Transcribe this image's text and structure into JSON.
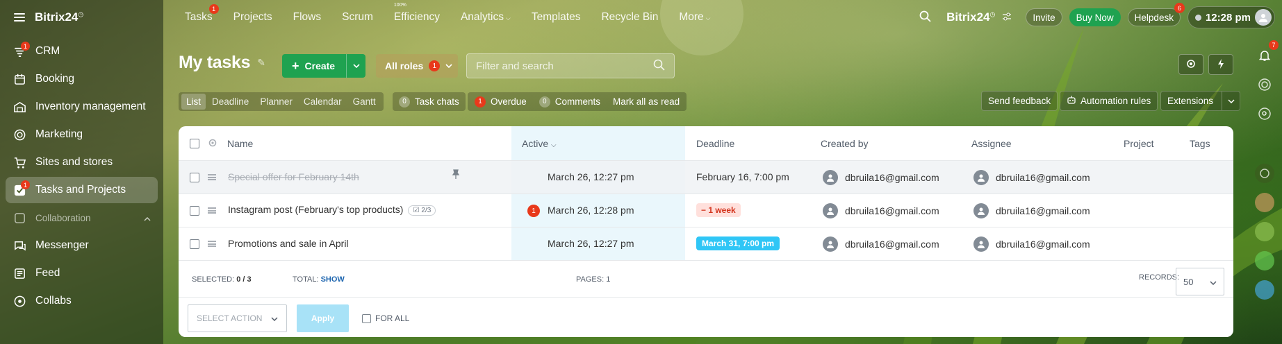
{
  "brand": {
    "name": "Bitrix24",
    "mark": "◷"
  },
  "sidebar": {
    "items": [
      {
        "label": "CRM",
        "badge": "1"
      },
      {
        "label": "Booking"
      },
      {
        "label": "Inventory management"
      },
      {
        "label": "Marketing"
      },
      {
        "label": "Sites and stores"
      },
      {
        "label": "Tasks and Projects",
        "badge": "1"
      }
    ],
    "section": "Collaboration",
    "items2": [
      {
        "label": "Messenger"
      },
      {
        "label": "Feed"
      },
      {
        "label": "Collabs"
      }
    ]
  },
  "topnav": {
    "items": [
      "Tasks",
      "Projects",
      "Flows",
      "Scrum",
      "Efficiency",
      "Analytics",
      "Templates",
      "Recycle Bin",
      "More"
    ],
    "tasks_badge": "1",
    "efficiency_tiny": "100%",
    "invite": "Invite",
    "buy_now": "Buy Now",
    "helpdesk": "Helpdesk",
    "helpdesk_badge": "6",
    "time": "12:28 pm"
  },
  "rail": {
    "notifications_badge": "7"
  },
  "header": {
    "title": "My tasks",
    "create": "Create",
    "roles": "All roles",
    "roles_badge": "1",
    "search_placeholder": "Filter and search"
  },
  "toolbar": {
    "views": [
      "List",
      "Deadline",
      "Planner",
      "Calendar",
      "Gantt"
    ],
    "task_chats_count": "0",
    "task_chats": "Task chats",
    "overdue_count": "1",
    "overdue": "Overdue",
    "comments_count": "0",
    "comments": "Comments",
    "mark_all": "Mark all as read",
    "send_feedback": "Send feedback",
    "automation": "Automation rules",
    "extensions": "Extensions"
  },
  "table": {
    "columns": {
      "name": "Name",
      "active": "Active",
      "deadline": "Deadline",
      "created_by": "Created by",
      "assignee": "Assignee",
      "project": "Project",
      "tags": "Tags"
    },
    "rows": [
      {
        "name": "Special offer for February 14th",
        "active": "March 26, 12:27 pm",
        "deadline": "February 16, 7:00 pm",
        "created_by": "dbruila16@gmail.com",
        "assignee": "dbruila16@gmail.com"
      },
      {
        "name": "Instagram post (February's top products)",
        "checklist": "2/3",
        "counter": "1",
        "active": "March 26, 12:28 pm",
        "deadline": "− 1 week",
        "created_by": "dbruila16@gmail.com",
        "assignee": "dbruila16@gmail.com"
      },
      {
        "name": "Promotions and sale in April",
        "active": "March 26, 12:27 pm",
        "deadline": "March 31, 7:00 pm",
        "created_by": "dbruila16@gmail.com",
        "assignee": "dbruila16@gmail.com"
      }
    ],
    "footer": {
      "selected_label": "Selected:",
      "selected_value": "0 / 3",
      "total_label": "Total:",
      "total_link": "Show",
      "pages_label": "Pages:",
      "pages_value": "1",
      "records_label": "Records:",
      "records_value": "50",
      "action_placeholder": "Select action",
      "apply": "Apply",
      "for_all": "For all"
    }
  },
  "colors": {
    "green": "#1fa250",
    "red_badge": "#e8391b",
    "blue_deadline": "#2fc6f6",
    "active_column": "#eaf7fc"
  }
}
